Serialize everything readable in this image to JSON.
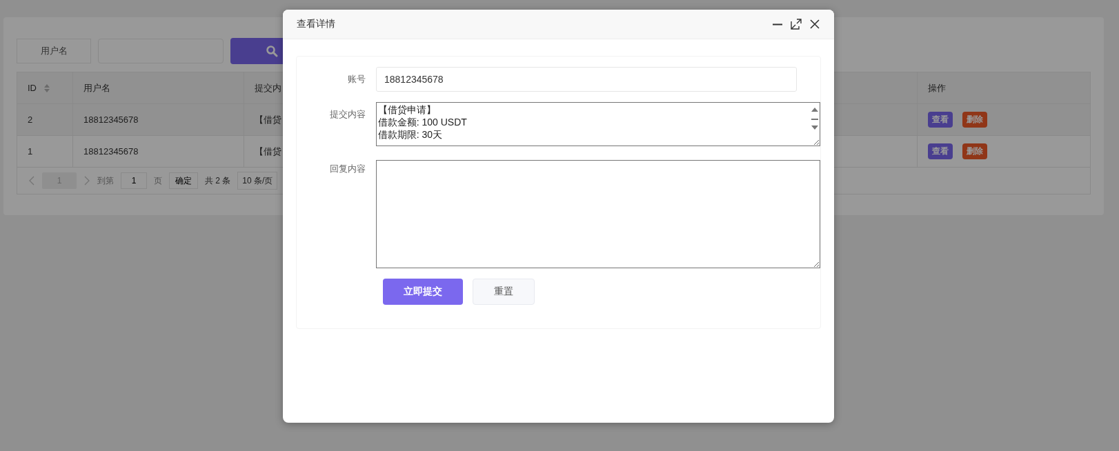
{
  "page": {
    "search": {
      "label": "用户名"
    },
    "table": {
      "columns": [
        {
          "label": "ID",
          "sortable": true
        },
        {
          "label": "用户名",
          "sortable": false
        },
        {
          "label": "提交内",
          "sortable": false
        },
        {
          "label": "操作",
          "sortable": false
        }
      ],
      "rows": [
        {
          "cells": [
            "2",
            "18812345678",
            "【借贷"
          ],
          "actions": [
            {
              "label": "查看",
              "kind": "view"
            },
            {
              "label": "删除",
              "kind": "delete"
            }
          ]
        },
        {
          "cells": [
            "1",
            "18812345678",
            "【借贷"
          ],
          "actions": [
            {
              "label": "查看",
              "kind": "view"
            },
            {
              "label": "删除",
              "kind": "delete"
            }
          ]
        }
      ]
    },
    "pagination": {
      "current": "1",
      "goto_label": "到第",
      "goto_value": "1",
      "page_unit": "页",
      "confirm": "确定",
      "total": "共 2 条",
      "page_size": "10 条/页"
    }
  },
  "dialog": {
    "title": "查看详情",
    "fields": [
      {
        "label": "账号",
        "kind": "input",
        "value": "18812345678"
      },
      {
        "label": "提交内容",
        "kind": "textarea",
        "lines": [
          "【借贷申请】",
          "借款金额: 100 USDT",
          "借款期限: 30天"
        ]
      },
      {
        "label": "回复内容",
        "kind": "textarea"
      }
    ],
    "buttons": [
      {
        "label": "立即提交",
        "kind": "primary"
      },
      {
        "label": "重置",
        "kind": "default"
      }
    ]
  }
}
